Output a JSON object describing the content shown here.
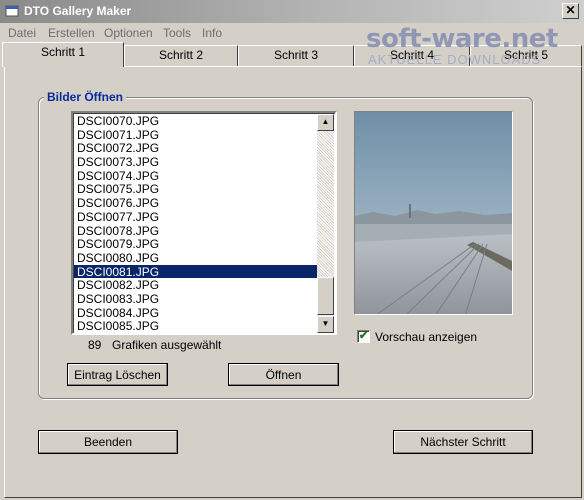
{
  "window": {
    "title": "DTO Gallery Maker"
  },
  "menu": [
    "Datei",
    "Erstellen",
    "Optionen",
    "Tools",
    "Info"
  ],
  "watermark": {
    "main": "soft-ware.net",
    "sub": "AKTUELLE DOWNLOADS"
  },
  "tabs": [
    {
      "label": "Schritt 1",
      "active": true
    },
    {
      "label": "Schritt 2",
      "active": false
    },
    {
      "label": "Schritt 3",
      "active": false
    },
    {
      "label": "Schritt 4",
      "active": false
    },
    {
      "label": "Schritt 5",
      "active": false
    }
  ],
  "group": {
    "title": "Bilder Öffnen"
  },
  "files": [
    "DSCI0070.JPG",
    "DSCI0071.JPG",
    "DSCI0072.JPG",
    "DSCI0073.JPG",
    "DSCI0074.JPG",
    "DSCI0075.JPG",
    "DSCI0076.JPG",
    "DSCI0077.JPG",
    "DSCI0078.JPG",
    "DSCI0079.JPG",
    "DSCI0080.JPG",
    "DSCI0081.JPG",
    "DSCI0082.JPG",
    "DSCI0083.JPG",
    "DSCI0084.JPG",
    "DSCI0085.JPG"
  ],
  "selected_file": "DSCI0081.JPG",
  "selection": {
    "count": "89",
    "label": "Grafiken ausgewählt"
  },
  "buttons": {
    "delete_entry": "Eintrag Löschen",
    "open": "Öffnen",
    "quit": "Beenden",
    "next_step": "Nächster Schritt"
  },
  "preview": {
    "checkbox_label": "Vorschau anzeigen",
    "checked": true
  },
  "icons": {
    "app": "app-window-icon",
    "close": "close-icon",
    "scroll_up": "scroll-up-arrow-icon",
    "scroll_down": "scroll-down-arrow-icon",
    "checkmark": "checkmark-icon"
  }
}
